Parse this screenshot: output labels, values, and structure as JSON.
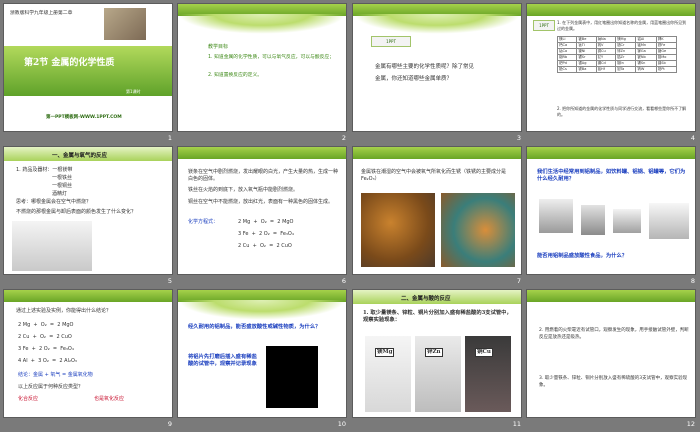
{
  "slides": [
    {
      "num": "1",
      "header": "浙教版科学九年级上册第二章",
      "title": "第2节  金属的化学性质",
      "sub": "第1课时",
      "footer": "第一PPT模板网-WWW.1PPT.COM"
    },
    {
      "num": "2",
      "label": "教学目标",
      "items": [
        "1. 知道金属的化学性质，可以与氧气反应，可以与酸反应；",
        "2. 知道置换反应的定义。"
      ]
    },
    {
      "num": "3",
      "q1": "金属有哪些主要的化学性质呢？除了常见",
      "q2": "金属，你还知道哪些金属单质？"
    },
    {
      "num": "4",
      "t1": "1. 在下列金属表中，用红笔圈出你知道名称的金属，用蓝笔圈出你所见到过的金属。",
      "t2": "2. 把你所知道的金属的化学性质与同学进行交流，看看哪些是你所不了解的。"
    },
    {
      "num": "5",
      "h": "一、金属与氧气的反应",
      "lines": [
        "1. 药品及器材：一根镁带",
        "一根铁丝",
        "一根铜丝",
        "酒精灯",
        "思考：哪根金属会在空气中燃烧？",
        "不燃烧的那根金属与卸后表面的颜色发生了什么变化？"
      ]
    },
    {
      "num": "6",
      "lines": [
        "镁条在空气中剧烈燃烧，发出耀眼的白光，产生大量的热，生成一种白色的固体。",
        "铁丝在火焰的到底下，放入氧气瓶中能剧烈燃烧。",
        "铜丝在空气中不能燃烧，放出红光，表面有一种黑色的固体生成。"
      ],
      "eq_label": "化学方程式："
    },
    {
      "num": "7",
      "lines": [
        "金属铁在潮湿的空气中会被氧气所氧化而生锈（铁锈的主要成分是Fe₂O₃）"
      ]
    },
    {
      "num": "8",
      "q": "我们生活中经常用到铝制品，如饮料罐、铝锅、铝罐等，它们为什么经久耐用？",
      "q2": "能否用铝制品盛放酸性食品，为什么？"
    },
    {
      "num": "9",
      "lines": [
        "通过上述实验及实例，你能得出什么结论？",
        "结论：金属 + 氧气 = 金属氧化物",
        "以上反应属于何种反应类型？",
        "化合反应",
        "也是氧化反应"
      ]
    },
    {
      "num": "10",
      "q": "经久耐用的铝制品，能否盛放酸性或碱性物质，为什么？",
      "q2": "将铝片先打磨后插入盛有稀盐酸的试管中，观察并记录现象"
    },
    {
      "num": "11",
      "h": "二、金属与酸的反应",
      "s": "1. 取少量镁条、锌粒、铜片分别加入盛有稀盐酸的3支试管中，观察实验现象：",
      "tubes": [
        "镁Mg",
        "锌Zn",
        "铜Cu"
      ]
    },
    {
      "num": "12",
      "t1": "2. 用燃着的火柴靠近有试管口，观察发生的现象，用手接触试管外壁，判断反应是放热还是吸热。",
      "t2": "3. 取少量铁条、锌粒、铜片分别放入盛有稀硫酸的3支试管中，观察实验现象。"
    }
  ],
  "colors": {
    "green_light": "#a6d14a",
    "green_dark": "#6aa526",
    "red": "#c8102e",
    "blue": "#1b3fbf",
    "background": "#7a7a7a"
  }
}
